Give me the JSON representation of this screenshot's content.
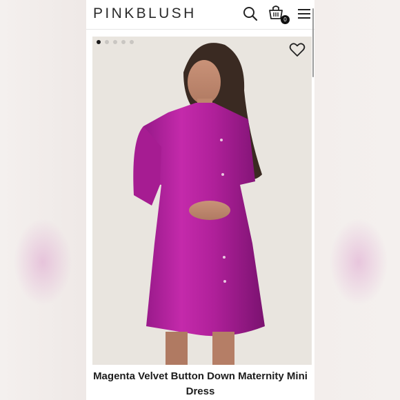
{
  "brand": {
    "logo_text": "PINKBLUSH"
  },
  "header": {
    "cart_count": "0",
    "icons": [
      "search-icon",
      "shopping-bag-icon",
      "hamburger-menu-icon"
    ]
  },
  "gallery": {
    "slides_total": 5,
    "active_slide": 1,
    "wishlist_icon": "heart-icon"
  },
  "product": {
    "title": "Magenta Velvet Button Down Maternity Mini Dress",
    "color": "#b0209a"
  },
  "colors": {
    "accent": "#b0209a",
    "background": "#eae6e1"
  }
}
